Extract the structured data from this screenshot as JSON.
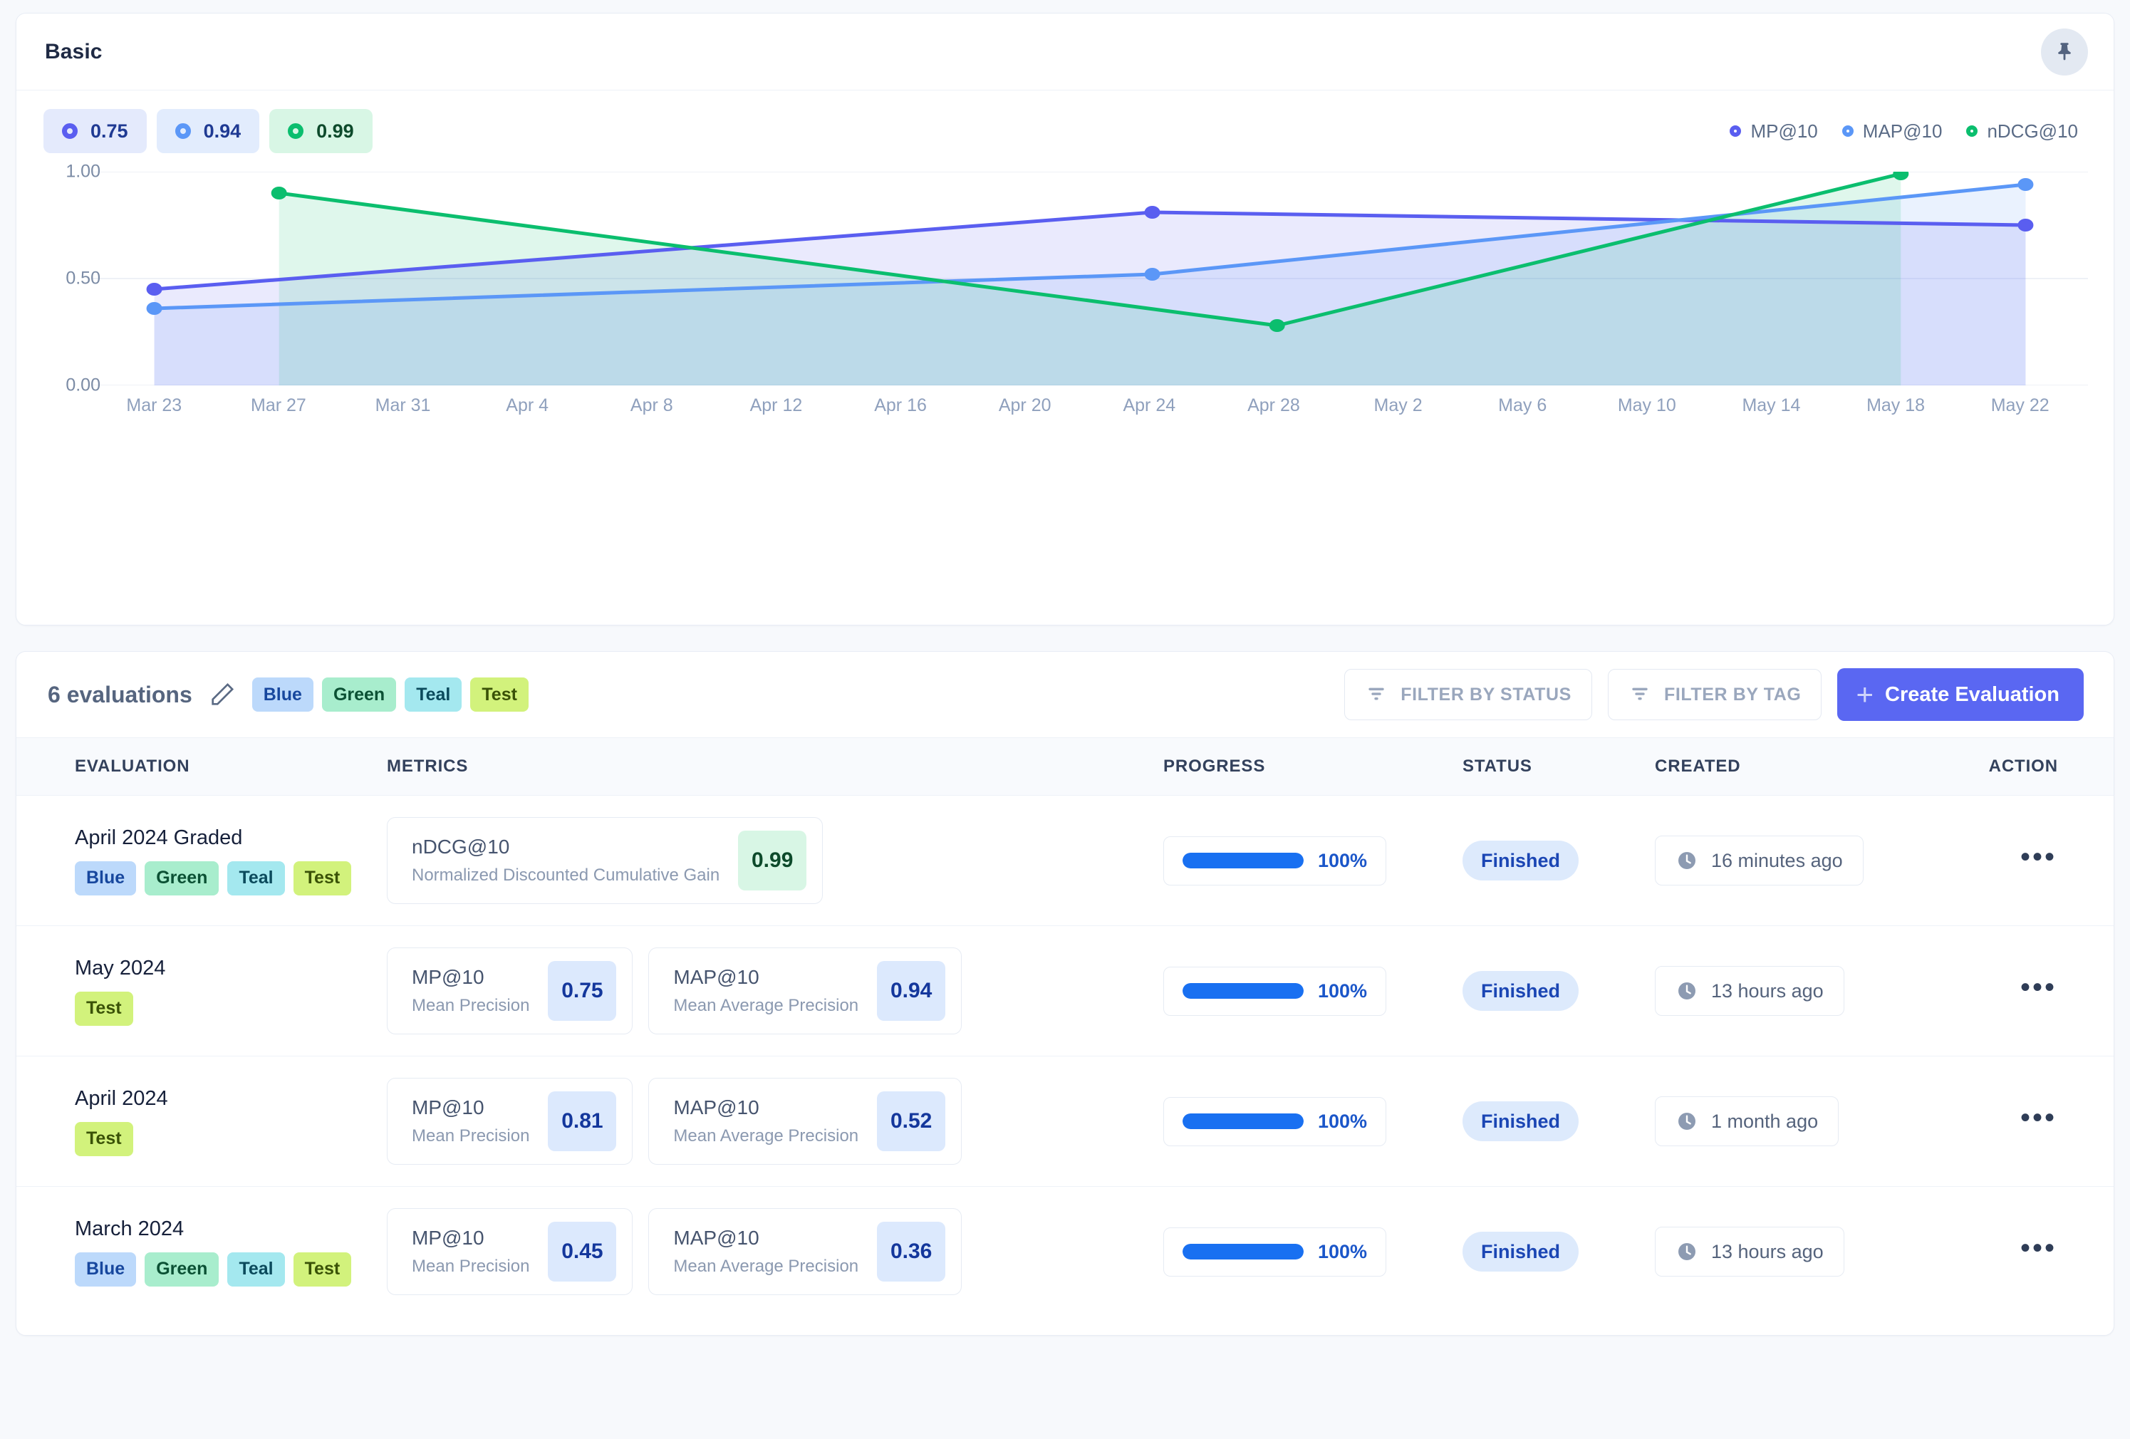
{
  "chart_panel": {
    "title": "Basic",
    "pin_icon": "pin-icon",
    "summary_chips": [
      {
        "value": "0.75",
        "color": "#5a5ef0"
      },
      {
        "value": "0.94",
        "color": "#5b97f7"
      },
      {
        "value": "0.99",
        "color": "#0bbe6e"
      }
    ],
    "legend": [
      {
        "label": "MP@10",
        "color": "#5a5ef0"
      },
      {
        "label": "MAP@10",
        "color": "#5b97f7"
      },
      {
        "label": "nDCG@10",
        "color": "#0bbe6e"
      }
    ]
  },
  "chart_data": {
    "type": "line",
    "title": "Basic",
    "xlabel": "",
    "ylabel": "",
    "ylim": [
      0.0,
      1.0
    ],
    "yticks": [
      "0.00",
      "0.50",
      "1.00"
    ],
    "grid": true,
    "legend_position": "top-right",
    "x": [
      "Mar 23",
      "Mar 27",
      "Mar 31",
      "Apr 4",
      "Apr 8",
      "Apr 12",
      "Apr 16",
      "Apr 20",
      "Apr 24",
      "Apr 28",
      "May 2",
      "May 6",
      "May 10",
      "May 14",
      "May 18",
      "May 22"
    ],
    "series": [
      {
        "name": "MP@10",
        "color": "#5a5ef0",
        "points": [
          {
            "x": "Mar 23",
            "y": 0.45
          },
          {
            "x": "Apr 24",
            "y": 0.81
          },
          {
            "x": "May 22",
            "y": 0.75
          }
        ]
      },
      {
        "name": "MAP@10",
        "color": "#5b97f7",
        "points": [
          {
            "x": "Mar 23",
            "y": 0.36
          },
          {
            "x": "Apr 24",
            "y": 0.52
          },
          {
            "x": "May 22",
            "y": 0.94
          }
        ]
      },
      {
        "name": "nDCG@10",
        "color": "#0bbe6e",
        "points": [
          {
            "x": "Mar 27",
            "y": 0.9
          },
          {
            "x": "Apr 28",
            "y": 0.28
          },
          {
            "x": "May 18",
            "y": 0.99
          }
        ]
      }
    ]
  },
  "table_panel": {
    "count_label": "6 evaluations",
    "edit_icon": "edit-pencil-icon",
    "tags": [
      {
        "label": "Blue",
        "class": "t-blue"
      },
      {
        "label": "Green",
        "class": "t-green"
      },
      {
        "label": "Teal",
        "class": "t-teal"
      },
      {
        "label": "Test",
        "class": "t-test"
      }
    ],
    "filter_status_label": "FILTER BY STATUS",
    "filter_tag_label": "FILTER BY TAG",
    "create_label": "Create Evaluation",
    "columns": [
      "EVALUATION",
      "METRICS",
      "PROGRESS",
      "STATUS",
      "CREATED",
      "ACTION"
    ],
    "rows": [
      {
        "name": "April 2024 Graded",
        "tags": [
          {
            "label": "Blue",
            "class": "t-blue"
          },
          {
            "label": "Green",
            "class": "t-green"
          },
          {
            "label": "Teal",
            "class": "t-teal"
          },
          {
            "label": "Test",
            "class": "t-test"
          }
        ],
        "metrics": [
          {
            "key": "nDCG@10",
            "desc": "Normalized Discounted Cumulative Gain",
            "value": "0.99",
            "value_class": "mv-green"
          }
        ],
        "progress": "100%",
        "progress_pct": 100,
        "status": "Finished",
        "created": "16 minutes ago",
        "action": "•••"
      },
      {
        "name": "May 2024",
        "tags": [
          {
            "label": "Test",
            "class": "t-test"
          }
        ],
        "metrics": [
          {
            "key": "MP@10",
            "desc": "Mean Precision",
            "value": "0.75",
            "value_class": "mv-blue"
          },
          {
            "key": "MAP@10",
            "desc": "Mean Average Precision",
            "value": "0.94",
            "value_class": "mv-blue"
          }
        ],
        "progress": "100%",
        "progress_pct": 100,
        "status": "Finished",
        "created": "13 hours ago",
        "action": "•••"
      },
      {
        "name": "April 2024",
        "tags": [
          {
            "label": "Test",
            "class": "t-test"
          }
        ],
        "metrics": [
          {
            "key": "MP@10",
            "desc": "Mean Precision",
            "value": "0.81",
            "value_class": "mv-blue"
          },
          {
            "key": "MAP@10",
            "desc": "Mean Average Precision",
            "value": "0.52",
            "value_class": "mv-blue"
          }
        ],
        "progress": "100%",
        "progress_pct": 100,
        "status": "Finished",
        "created": "1 month ago",
        "action": "•••"
      },
      {
        "name": "March 2024",
        "tags": [
          {
            "label": "Blue",
            "class": "t-blue"
          },
          {
            "label": "Green",
            "class": "t-green"
          },
          {
            "label": "Teal",
            "class": "t-teal"
          },
          {
            "label": "Test",
            "class": "t-test"
          }
        ],
        "metrics": [
          {
            "key": "MP@10",
            "desc": "Mean Precision",
            "value": "0.45",
            "value_class": "mv-blue"
          },
          {
            "key": "MAP@10",
            "desc": "Mean Average Precision",
            "value": "0.36",
            "value_class": "mv-blue"
          }
        ],
        "progress": "100%",
        "progress_pct": 100,
        "status": "Finished",
        "created": "13 hours ago",
        "action": "•••"
      }
    ]
  }
}
